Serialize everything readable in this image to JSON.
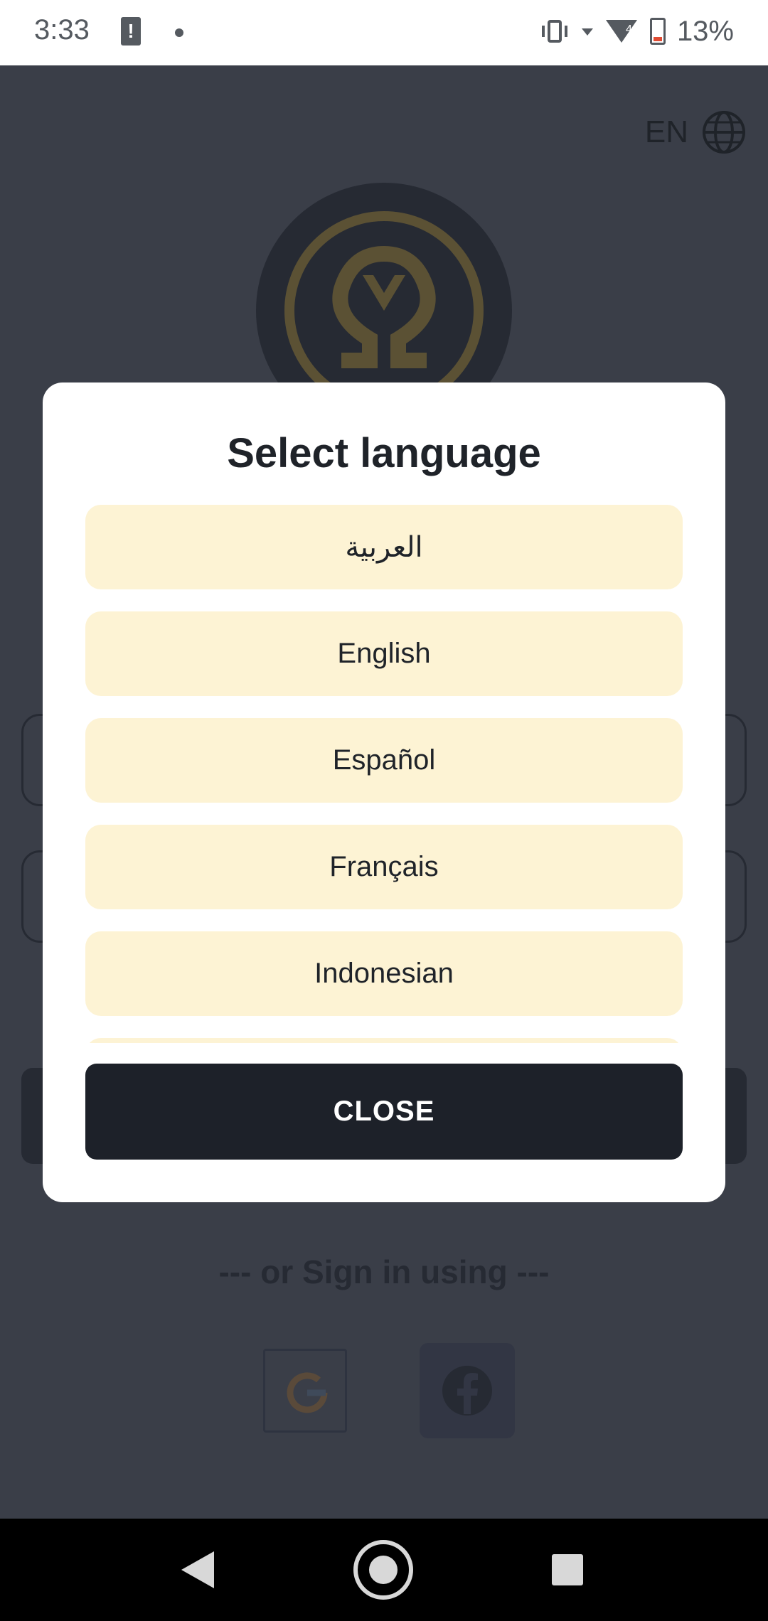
{
  "status_bar": {
    "time": "3:33",
    "battery_percent": "13%"
  },
  "background": {
    "language_code": "EN",
    "sign_in_using": "--- or Sign in using ---",
    "icons": [
      "globe-icon",
      "google-icon",
      "facebook-icon"
    ]
  },
  "dialog": {
    "title": "Select language",
    "languages": [
      "العربية",
      "English",
      "Español",
      "Français",
      "Indonesian"
    ],
    "close_label": "CLOSE"
  },
  "colors": {
    "option_bg": "#fdf3d4",
    "close_bg": "#1d2129",
    "overlay": "#3a3e48"
  }
}
